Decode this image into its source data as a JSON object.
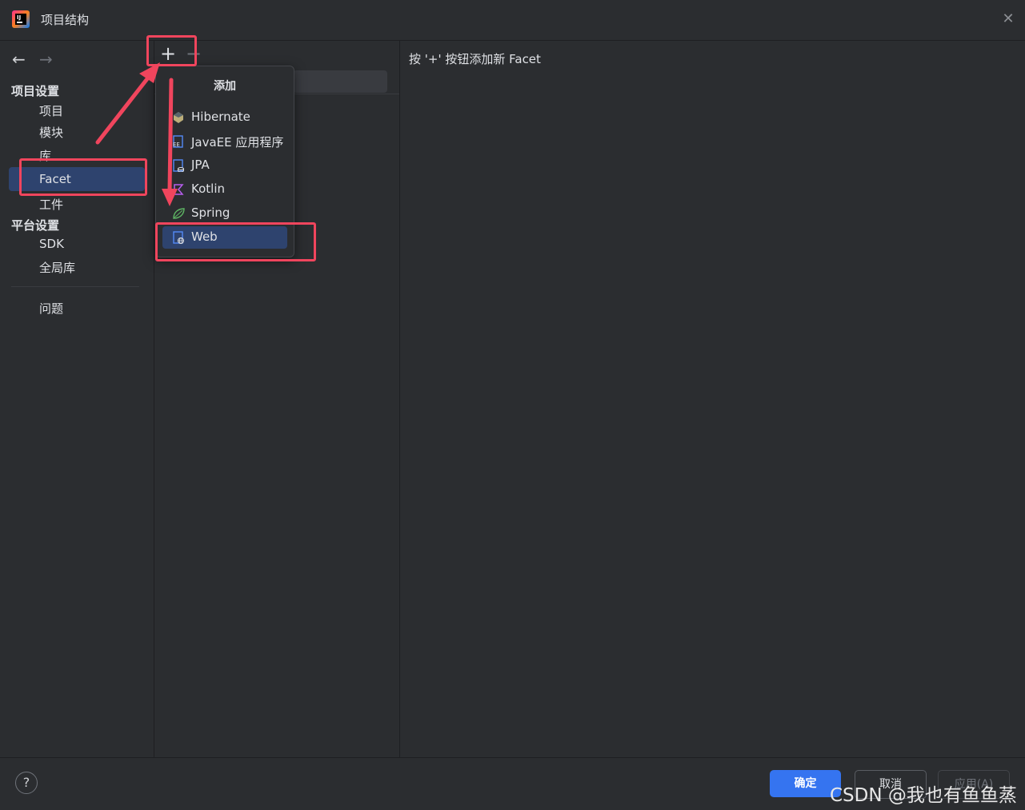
{
  "window": {
    "title": "项目结构",
    "close_icon": "✕"
  },
  "sidebar": {
    "back_icon": "←",
    "forward_icon": "→",
    "project_settings_header": "项目设置",
    "items_project": [
      "项目",
      "模块",
      "库",
      "Facet",
      "工件"
    ],
    "platform_settings_header": "平台设置",
    "items_platform": [
      "SDK",
      "全局库"
    ],
    "problems": "问题",
    "selected": "Facet"
  },
  "toolbar": {
    "add_icon": "+",
    "remove_icon": "−"
  },
  "popup": {
    "title": "添加",
    "items": [
      {
        "label": "Hibernate",
        "icon": "hibernate-icon"
      },
      {
        "label": "JavaEE 应用程序",
        "icon": "javaee-icon"
      },
      {
        "label": "JPA",
        "icon": "jpa-icon"
      },
      {
        "label": "Kotlin",
        "icon": "kotlin-icon"
      },
      {
        "label": "Spring",
        "icon": "spring-icon"
      },
      {
        "label": "Web",
        "icon": "web-icon"
      }
    ],
    "selected": "Web"
  },
  "main": {
    "hint": "按 '+' 按钮添加新 Facet"
  },
  "footer": {
    "help": "?",
    "ok": "确定",
    "cancel": "取消",
    "apply": "应用(A)"
  },
  "watermark": "CSDN @我也有鱼鱼蒸",
  "colors": {
    "accent": "#3574f0",
    "selection": "#2e436e",
    "annotation": "#f0455d",
    "background": "#2b2d30"
  }
}
